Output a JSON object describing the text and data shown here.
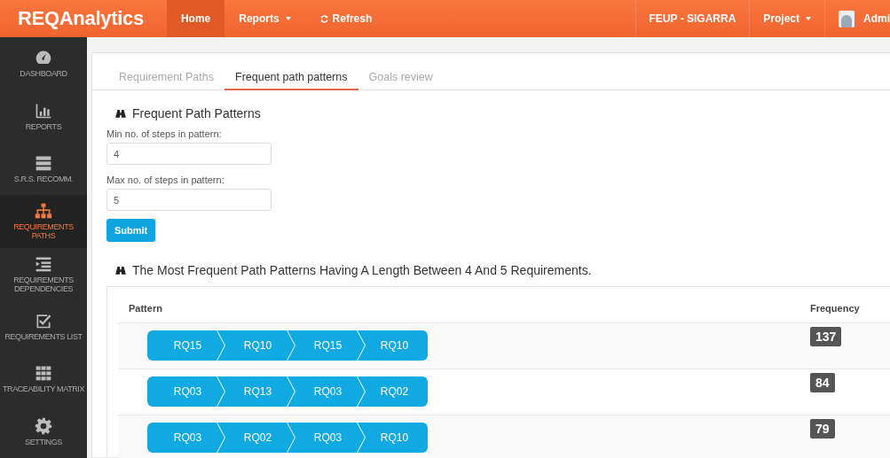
{
  "topbar": {
    "brand": "REQAnalytics",
    "nav": [
      {
        "label": "Home",
        "selected": true,
        "kind": "link"
      },
      {
        "label": "Reports",
        "selected": false,
        "kind": "dropdown"
      },
      {
        "label": "Refresh",
        "selected": false,
        "kind": "refresh"
      }
    ],
    "right": [
      {
        "label": "FEUP - SIGARRA",
        "kind": "link"
      },
      {
        "label": "Project",
        "kind": "dropdown"
      },
      {
        "label": "Admi",
        "kind": "user"
      }
    ]
  },
  "sidebar": {
    "items": [
      {
        "label": "DASHBOARD",
        "selected": false
      },
      {
        "label": "REPORTS",
        "selected": false
      },
      {
        "label": "S.R.S. RECOMM.",
        "selected": false
      },
      {
        "label": "REQUIREMENTS PATHS",
        "selected": true
      },
      {
        "label": "REQUIREMENTS DEPENDENCIES",
        "selected": false
      },
      {
        "label": "REQUIREMENTS LIST",
        "selected": false
      },
      {
        "label": "TRACEABILITY MATRIX",
        "selected": false
      },
      {
        "label": "SETTINGS",
        "selected": false
      }
    ]
  },
  "tabs": [
    {
      "label": "Requirement Paths",
      "selected": false
    },
    {
      "label": "Frequent path patterns",
      "selected": true
    },
    {
      "label": "Goals review",
      "selected": false
    }
  ],
  "form": {
    "title": "Frequent Path Patterns",
    "fields": [
      {
        "label": "Min no. of steps in pattern:",
        "value": "4"
      },
      {
        "label": "Max no. of steps in pattern:",
        "value": "5"
      }
    ],
    "submit": "Submit"
  },
  "results": {
    "title": "The Most Frequent Path Patterns Having A Length Between 4 And 5 Requirements.",
    "columns": [
      "Pattern",
      "Frequency"
    ],
    "rows": [
      {
        "steps": [
          "RQ15",
          "RQ10",
          "RQ15",
          "RQ10"
        ],
        "frequency": "137"
      },
      {
        "steps": [
          "RQ03",
          "RQ13",
          "RQ03",
          "RQ02"
        ],
        "frequency": "84"
      },
      {
        "steps": [
          "RQ03",
          "RQ02",
          "RQ03",
          "RQ10"
        ],
        "frequency": "79"
      }
    ]
  }
}
